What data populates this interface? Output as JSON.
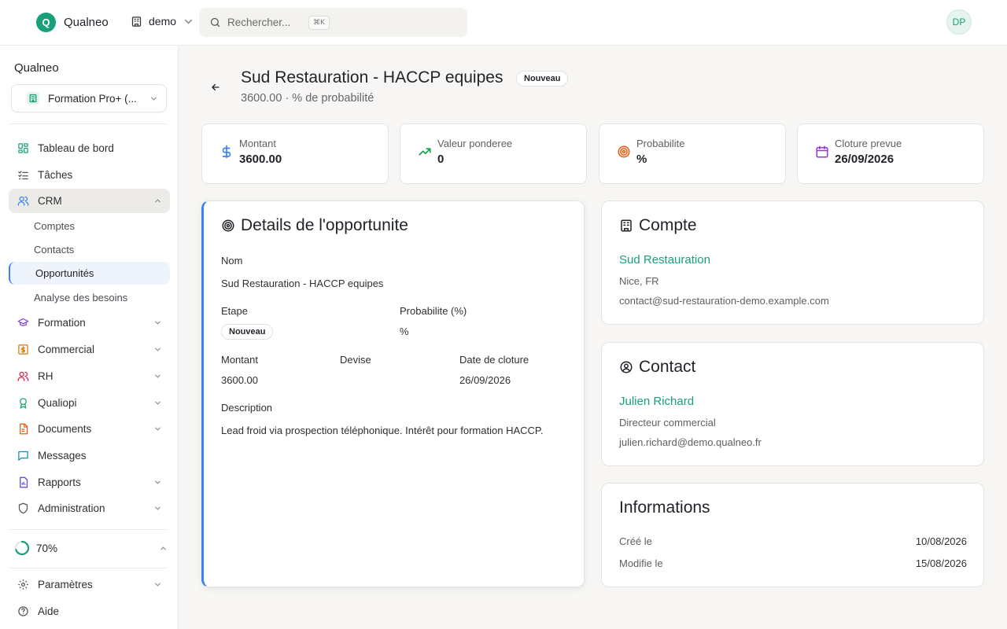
{
  "brand": {
    "logo_letter": "Q",
    "name": "Qualneo"
  },
  "tenant": {
    "label": "demo"
  },
  "search": {
    "placeholder": "Rechercher...",
    "shortcut": "⌘K"
  },
  "user": {
    "initials": "DP"
  },
  "sidebar": {
    "org_title": "Qualneo",
    "org_select": "Formation Pro+ (...",
    "items": [
      {
        "label": "Tableau de bord",
        "icon": "dashboard-icon"
      },
      {
        "label": "Tâches",
        "icon": "tasks-icon"
      },
      {
        "label": "CRM",
        "icon": "users-icon",
        "expanded": true
      },
      {
        "label": "Formation",
        "icon": "graduation-cap-icon"
      },
      {
        "label": "Commercial",
        "icon": "dollar-icon"
      },
      {
        "label": "RH",
        "icon": "people-icon"
      },
      {
        "label": "Qualiopi",
        "icon": "award-icon"
      },
      {
        "label": "Documents",
        "icon": "file-icon"
      },
      {
        "label": "Messages",
        "icon": "message-icon"
      },
      {
        "label": "Rapports",
        "icon": "report-icon"
      },
      {
        "label": "Administration",
        "icon": "shield-icon"
      }
    ],
    "crm_sub": [
      "Comptes",
      "Contacts",
      "Opportunités",
      "Analyse des besoins"
    ],
    "progress": {
      "label": "70%",
      "value": 0.7
    },
    "bottom": [
      {
        "label": "Paramètres",
        "icon": "gear-icon"
      },
      {
        "label": "Aide",
        "icon": "help-icon"
      }
    ]
  },
  "page": {
    "title": "Sud Restauration - HACCP equipes",
    "badge": "Nouveau",
    "subtitle": "3600.00 · % de probabilité"
  },
  "stats": [
    {
      "label": "Montant",
      "value": "3600.00",
      "color": "#3b82f6"
    },
    {
      "label": "Valeur ponderee",
      "value": "0",
      "color": "#16a34a"
    },
    {
      "label": "Probabilite",
      "value": "%",
      "color": "#ea580c"
    },
    {
      "label": "Cloture prevue",
      "value": "26/09/2026",
      "color": "#9333ea"
    }
  ],
  "details": {
    "heading": "Details de l'opportunite",
    "nom_label": "Nom",
    "nom_value": "Sud Restauration - HACCP equipes",
    "etape_label": "Etape",
    "etape_value": "Nouveau",
    "prob_label": "Probabilite (%)",
    "prob_value": "%",
    "montant_label": "Montant",
    "montant_value": "3600.00",
    "devise_label": "Devise",
    "date_label": "Date de cloture",
    "date_value": "26/09/2026",
    "desc_label": "Description",
    "desc_value": "Lead froid via prospection téléphonique. Intérêt pour formation HACCP."
  },
  "compte": {
    "heading": "Compte",
    "name": "Sud Restauration",
    "location": "Nice, FR",
    "email": "contact@sud-restauration-demo.example.com"
  },
  "contact": {
    "heading": "Contact",
    "name": "Julien Richard",
    "role": "Directeur commercial",
    "email": "julien.richard@demo.qualneo.fr"
  },
  "informations": {
    "heading": "Informations",
    "created_label": "Créé le",
    "created_value": "10/08/2026",
    "modified_label": "Modifie le",
    "modified_value": "15/08/2026"
  }
}
